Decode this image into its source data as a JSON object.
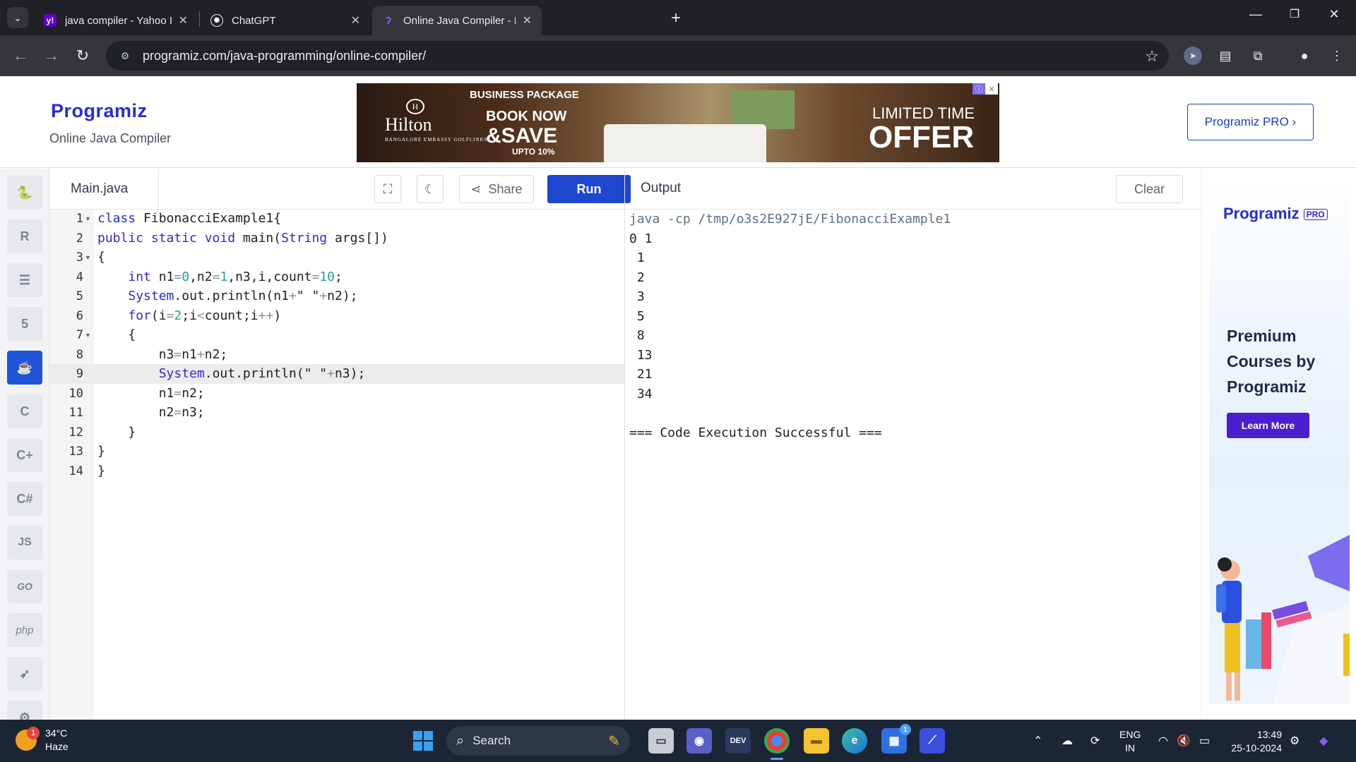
{
  "browser": {
    "tabs": [
      {
        "title": "java compiler - Yahoo India Sea",
        "favicon": "yahoo-icon"
      },
      {
        "title": "ChatGPT",
        "favicon": "chatgpt-icon"
      },
      {
        "title": "Online Java Compiler - Program",
        "favicon": "programiz-icon",
        "active": true
      }
    ],
    "url": "programiz.com/java-programming/online-compiler/"
  },
  "header": {
    "logo": "Programiz",
    "subtitle": "Online Java Compiler",
    "pro_button": "Programiz PRO ›"
  },
  "banner_ad": {
    "brand": "Hilton",
    "brand_sub": "BANGALORE EMBASSY GOLFLINKS",
    "package": "BUSINESS PACKAGE",
    "line1": "BOOK NOW",
    "line2": "&SAVE",
    "line3": "UPTO 10%",
    "offer_small": "LIMITED TIME",
    "offer_big": "OFFER"
  },
  "languages": [
    "python-icon",
    "r-icon",
    "sql-icon",
    "html-icon",
    "java-icon",
    "c-icon",
    "cpp-icon",
    "csharp-icon",
    "JS",
    "GO",
    "php",
    "swift-icon",
    "rust-icon"
  ],
  "editor": {
    "filename": "Main.java",
    "share_label": "Share",
    "run_label": "Run",
    "line_numbers": [
      "1",
      "2",
      "3",
      "4",
      "5",
      "6",
      "7",
      "8",
      "9",
      "10",
      "11",
      "12",
      "13",
      "14"
    ]
  },
  "output": {
    "title": "Output",
    "clear_label": "Clear",
    "lines": [
      "java -cp /tmp/o3s2E927jE/FibonacciExample1",
      "0 1",
      " 1",
      " 2",
      " 3",
      " 5",
      " 8",
      " 13",
      " 21",
      " 34",
      "",
      "=== Code Execution Successful ==="
    ]
  },
  "side_ad": {
    "logo": "Programiz",
    "badge": "PRO",
    "headline": "Premium Courses by Programiz",
    "button": "Learn More"
  },
  "taskbar": {
    "temperature": "34°C",
    "weather": "Haze",
    "weather_badge": "1",
    "search": "Search",
    "lang_top": "ENG",
    "lang_bottom": "IN",
    "time": "13:49",
    "date": "25-10-2024",
    "store_badge": "1"
  },
  "colors": {
    "accent": "#1e46cf",
    "active_language": "#1f54d8",
    "keyword": "#2b2bd6"
  }
}
